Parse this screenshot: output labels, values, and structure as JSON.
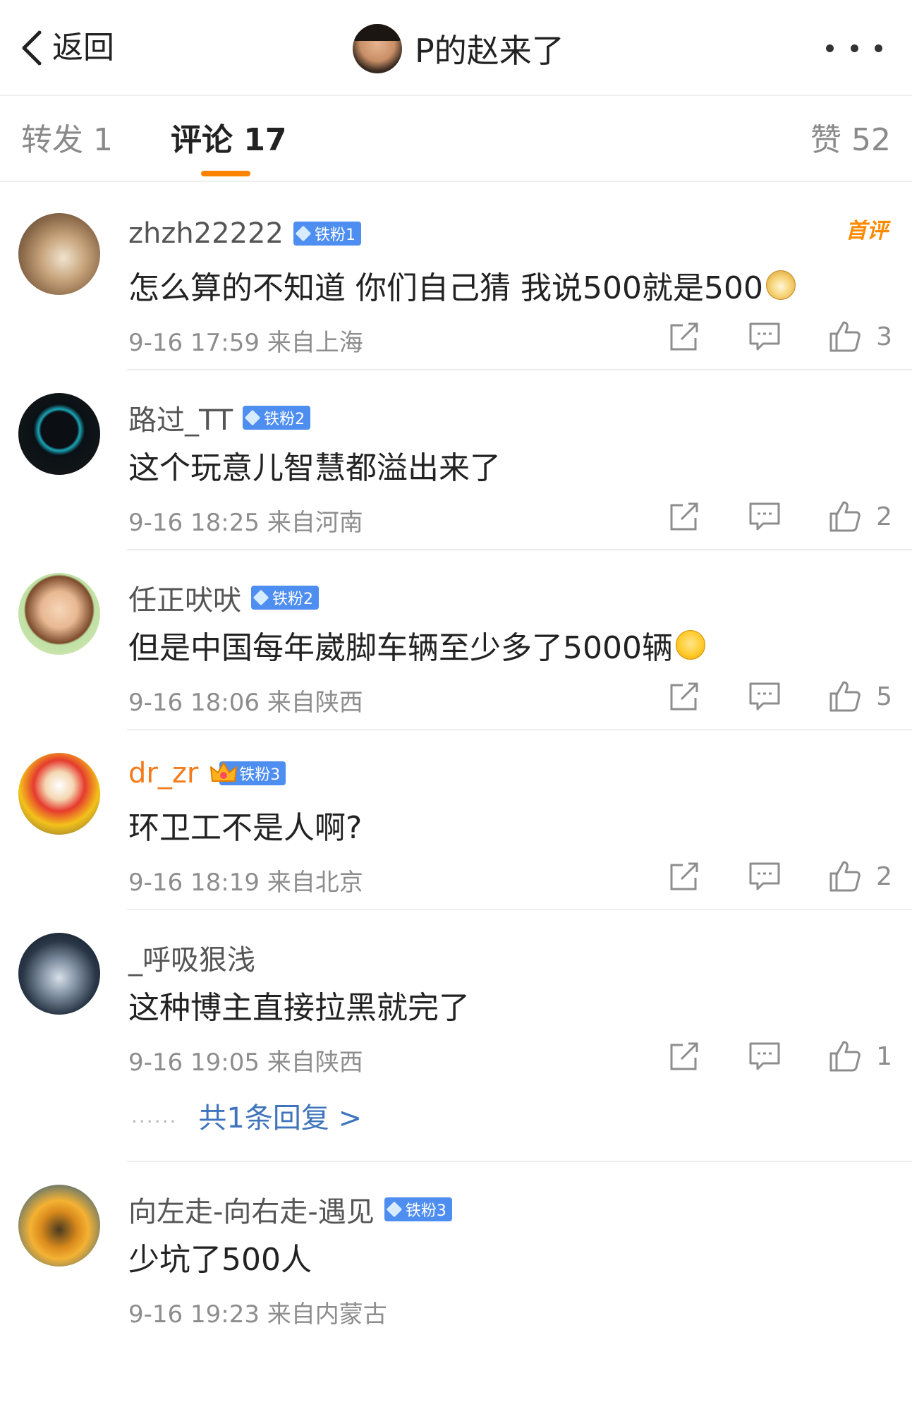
{
  "header": {
    "back_label": "返回",
    "title": "P的赵来了"
  },
  "tabs": {
    "repost": "转发 1",
    "comment": "评论 17",
    "like": "赞 52"
  },
  "colors": {
    "accent": "#ff8200",
    "badge_blue": "#4e8ef0",
    "link_blue": "#3f74bd",
    "gold_name": "#f47c1c"
  },
  "comments": [
    {
      "user": "zhzh22222",
      "badge": "铁粉1",
      "first_tag": "首评",
      "text": "怎么算的不知道 你们自己猜  我说500就是500",
      "emoji": "doge-emoji",
      "meta": "9-16 17:59 来自上海",
      "likes": "3"
    },
    {
      "user": "路过_TT",
      "badge": "铁粉2",
      "text": "这个玩意儿智慧都溢出来了",
      "meta": "9-16 18:25 来自河南",
      "likes": "2"
    },
    {
      "user": "任正吠吠",
      "badge": "铁粉2",
      "text": "但是中国每年崴脚车辆至少多了5000辆",
      "emoji": "laugh-cry-emoji",
      "meta": "9-16 18:06 来自陕西",
      "likes": "5"
    },
    {
      "user": "dr_zr",
      "badge": "铁粉3",
      "text": "环卫工不是人啊?",
      "meta": "9-16 18:19 来自北京",
      "likes": "2"
    },
    {
      "user": "_呼吸狠浅",
      "text": "这种博主直接拉黑就完了",
      "meta": "9-16 19:05 来自陕西",
      "likes": "1",
      "reply_dots": "......",
      "reply_link": "共1条回复 >"
    },
    {
      "user": "向左走-向右走-遇见",
      "badge": "铁粉3",
      "text": "少坑了500人",
      "meta": "9-16 19:23 来自内蒙古"
    }
  ]
}
